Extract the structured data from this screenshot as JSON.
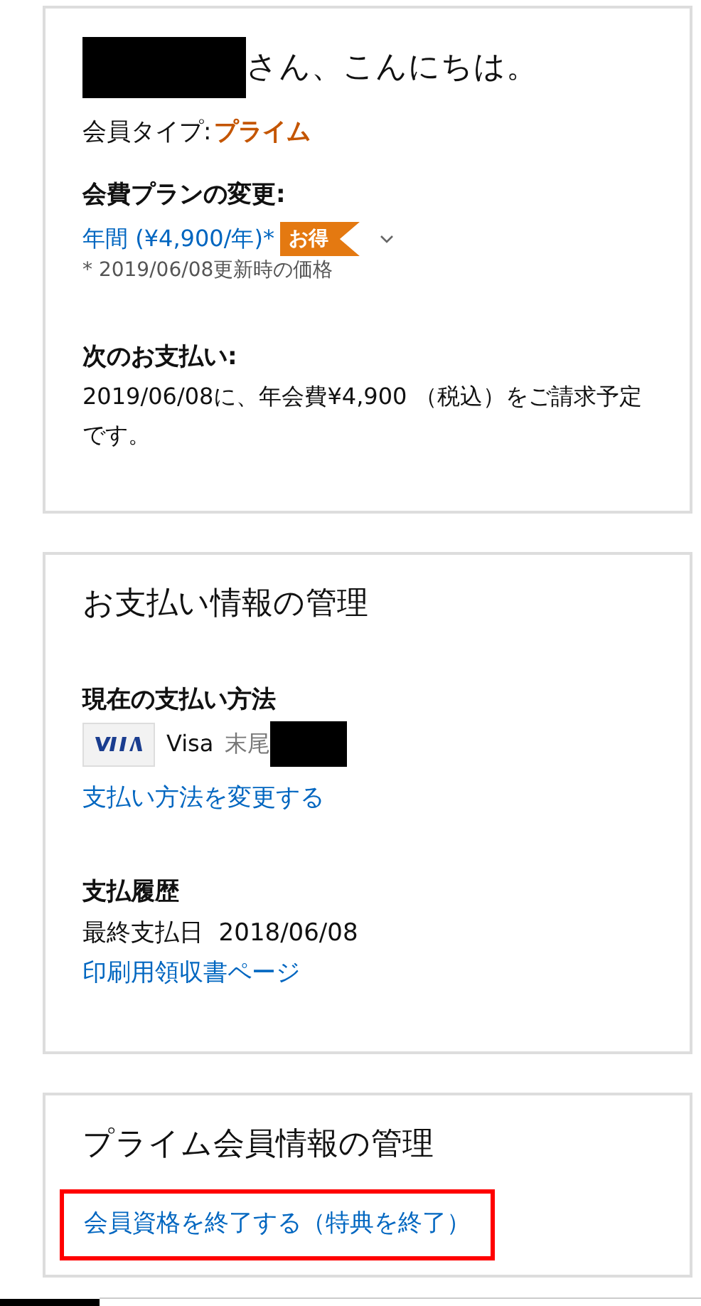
{
  "membership": {
    "greeting": "さん、こんにちは。",
    "type_label": "会員タイプ:",
    "type_value": "プライム",
    "plan_heading": "会費プランの変更:",
    "plan_value": "年間 (¥4,900/年)*",
    "plan_badge": "お得",
    "plan_note": "* 2019/06/08更新時の価格",
    "next_heading": "次のお支払い:",
    "next_text": "2019/06/08に、年会費¥4,900 （税込）をご請求予定です。"
  },
  "payment": {
    "title": "お支払い情報の管理",
    "method_heading": "現在の支払い方法",
    "card_brand": "Visa",
    "card_suffix_label": "末尾",
    "change_link": "支払い方法を変更する",
    "history_heading": "支払履歴",
    "last_payment": "最終支払日  2018/06/08",
    "receipt_link": "印刷用領収書ページ"
  },
  "prime": {
    "title": "プライム会員情報の管理",
    "end_link": "会員資格を終了する（特典を終了）",
    "highlighted": true
  }
}
